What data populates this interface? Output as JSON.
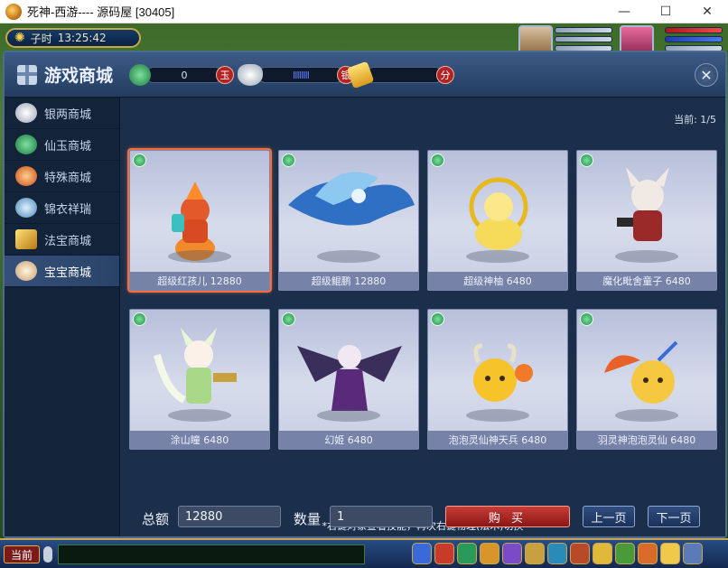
{
  "window": {
    "title": "死神-西游---- 源码屋 [30405]",
    "minimize": "—",
    "maximize": "☐",
    "close": "✕"
  },
  "hud": {
    "clock_label": "子时",
    "clock_time": "13:25:42"
  },
  "shop": {
    "title": "游戏商城",
    "close": "✕",
    "currencies": [
      {
        "icon": "jade-coin-icon",
        "value": "0",
        "unit": "玉"
      },
      {
        "icon": "silver-ingot-icon",
        "value": "IIIIIIII",
        "unit": "银"
      },
      {
        "icon": "points-ticket-icon",
        "value": "",
        "unit": "分"
      }
    ],
    "sidebar": [
      {
        "label": "银两商城",
        "icon": "silver-ingot-icon",
        "color": "#c9cfd8"
      },
      {
        "label": "仙玉商城",
        "icon": "jade-icon",
        "color": "#35b070"
      },
      {
        "label": "特殊商城",
        "icon": "flame-icon",
        "color": "#e0732b"
      },
      {
        "label": "锦衣祥瑞",
        "icon": "costume-icon",
        "color": "#8fc4e6"
      },
      {
        "label": "法宝商城",
        "icon": "flag-icon",
        "color": "#e2b33a"
      },
      {
        "label": "宝宝商城",
        "icon": "pet-face-icon",
        "color": "#f0d7b0",
        "active": true
      }
    ],
    "page_indicator": "当前: 1/5",
    "items": [
      {
        "label": "超级红孩儿 12880",
        "color": "#e87a2a",
        "selected": true
      },
      {
        "label": "超级鲲鹏 12880",
        "color": "#3a7bd0"
      },
      {
        "label": "超级神柚 6480",
        "color": "#f2d24a"
      },
      {
        "label": "魔化毗舍童子 6480",
        "color": "#c24a3a"
      },
      {
        "label": "涂山瞳 6480",
        "color": "#c7e7a8"
      },
      {
        "label": "幻姬 6480",
        "color": "#5a3a8a"
      },
      {
        "label": "泡泡灵仙神天兵 6480",
        "color": "#f3b82a"
      },
      {
        "label": "羽灵神泡泡灵仙 6480",
        "color": "#f1a33a"
      }
    ],
    "hint": "*右键对象查看技能，再次右键物理(法术)切换",
    "total_label": "总额",
    "total_value": "12880",
    "quantity_label": "数量",
    "quantity_value": "1",
    "buy_label": "购 买",
    "prev_label": "上一页",
    "next_label": "下一页"
  },
  "bottom_bar": {
    "chat_channel": "当前"
  }
}
